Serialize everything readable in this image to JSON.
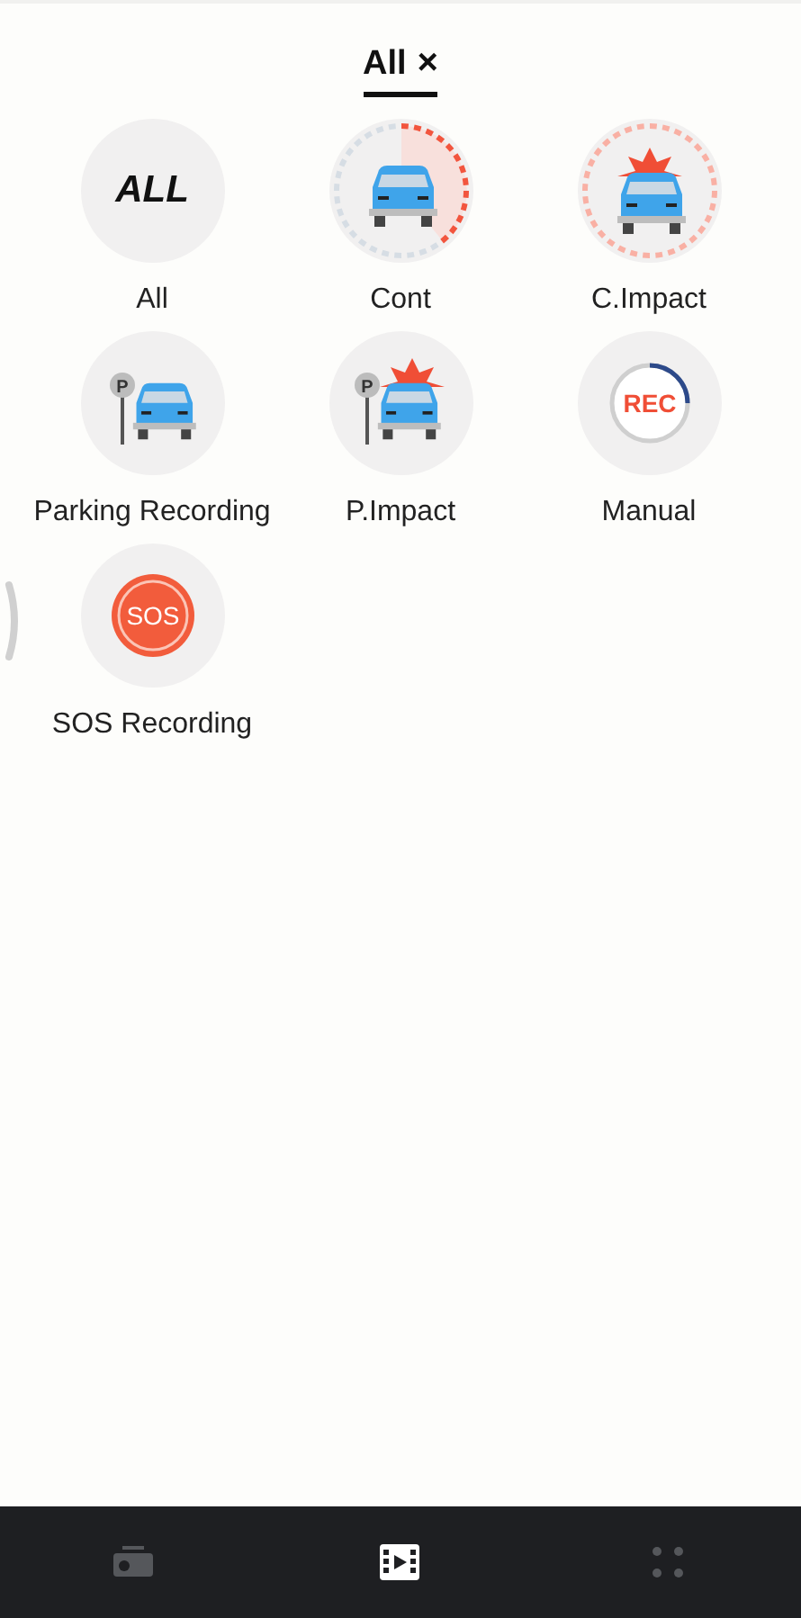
{
  "filter_tab": {
    "label": "All",
    "close": "×",
    "selected": true
  },
  "categories": [
    {
      "kind": "all",
      "label": "All",
      "badge_text": "ALL"
    },
    {
      "kind": "cont",
      "label": "Cont"
    },
    {
      "kind": "c-impact",
      "label": "C.Impact"
    },
    {
      "kind": "parking",
      "label": "Parking Recording",
      "badge_text": "P"
    },
    {
      "kind": "p-impact",
      "label": "P.Impact",
      "badge_text": "P"
    },
    {
      "kind": "manual",
      "label": "Manual",
      "badge_text": "REC"
    },
    {
      "kind": "sos",
      "label": "SOS Recording",
      "badge_text": "SOS"
    }
  ],
  "bottom_nav": [
    {
      "kind": "camera",
      "selected": false
    },
    {
      "kind": "videos",
      "selected": true
    },
    {
      "kind": "more",
      "selected": false
    }
  ]
}
